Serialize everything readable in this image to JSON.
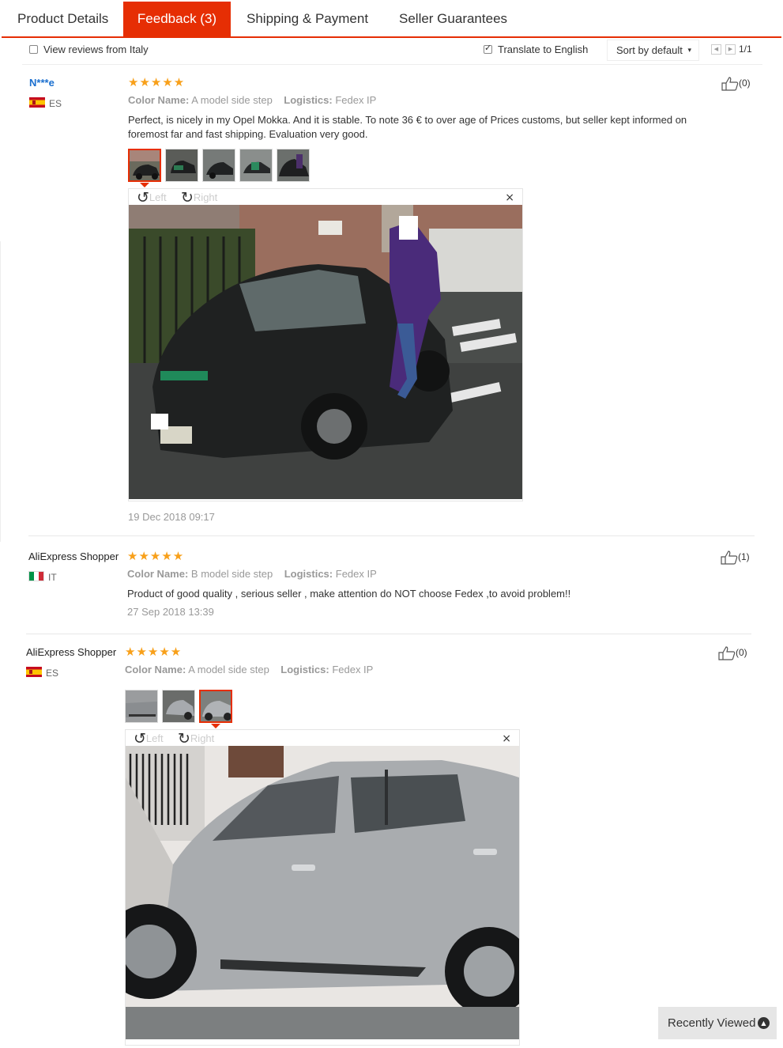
{
  "tabs": [
    {
      "label": "Product Details",
      "active": false
    },
    {
      "label": "Feedback (3)",
      "active": true
    },
    {
      "label": "Shipping & Payment",
      "active": false
    },
    {
      "label": "Seller Guarantees",
      "active": false
    }
  ],
  "filters": {
    "view_from_country": {
      "label": "View reviews from Italy",
      "checked": false
    },
    "translate": {
      "label": "Translate to English",
      "checked": true
    },
    "sort": {
      "label": "Sort by default"
    },
    "pagination": "1/1"
  },
  "reviews": [
    {
      "name": "N***e",
      "country": "ES",
      "stars": "★★★★★",
      "color_label": "Color Name:",
      "color_value": "A model side step",
      "logistics_label": "Logistics:",
      "logistics_value": "Fedex IP",
      "text": "Perfect, is nicely in my Opel Mokka. And it is stable. To note 36 € to over age of Prices customs, but seller kept informed on foremost far and fast shipping. Evaluation very good.",
      "date": "19 Dec 2018 09:17",
      "helpful": "(0)",
      "viewer": {
        "left_label": "Left",
        "right_label": "Right",
        "close": "×"
      }
    },
    {
      "name": "AliExpress Shopper",
      "country": "IT",
      "stars": "★★★★★",
      "color_label": "Color Name:",
      "color_value": "B model side step",
      "logistics_label": "Logistics:",
      "logistics_value": "Fedex IP",
      "text": "Product of good quality , serious seller , make attention do NOT choose Fedex ,to avoid problem!!",
      "date": "27 Sep 2018 13:39",
      "helpful": "(1)"
    },
    {
      "name": "AliExpress Shopper",
      "country": "ES",
      "stars": "★★★★★",
      "color_label": "Color Name:",
      "color_value": "A model side step",
      "logistics_label": "Logistics:",
      "logistics_value": "Fedex IP",
      "helpful": "(0)",
      "viewer": {
        "left_label": "Left",
        "right_label": "Right",
        "close": "×"
      }
    }
  ],
  "recently_viewed": "Recently Viewed",
  "colors": {
    "accent": "#e62e04",
    "star": "#f8a01a",
    "link": "#1a6fcf"
  }
}
